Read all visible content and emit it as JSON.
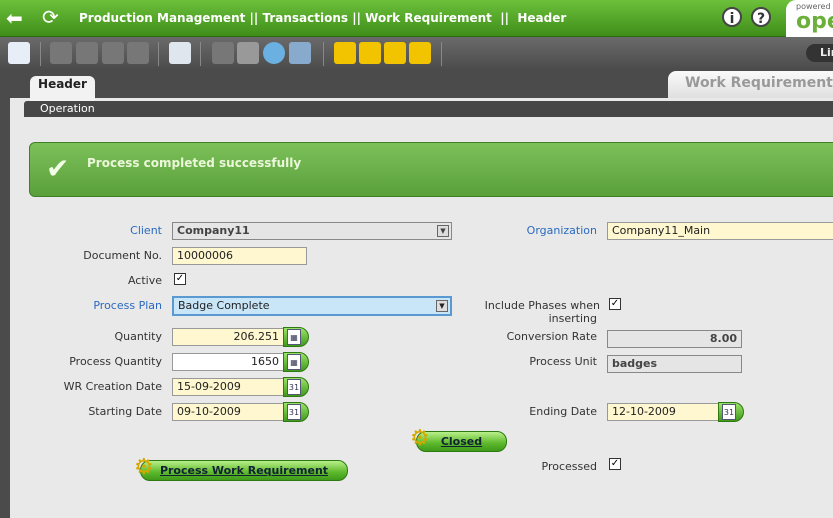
{
  "breadcrumb": "Production Management || Transactions || Work Requirement  ||  Header",
  "powered": {
    "line1": "powered",
    "line2": "ope"
  },
  "toolbar": {
    "link_label": "Lin"
  },
  "tabs": {
    "header": "Header",
    "window_title": "Work Requirement",
    "subtab": "Operation"
  },
  "message": "Process completed successfully",
  "colors": {
    "accent": "#4f9e24",
    "message_bg": "#6aae48"
  },
  "form": {
    "client": {
      "label": "Client",
      "value": "Company11"
    },
    "organization": {
      "label": "Organization",
      "value": "Company11_Main"
    },
    "document_no": {
      "label": "Document No.",
      "value": "10000006"
    },
    "active": {
      "label": "Active",
      "checked": true
    },
    "process_plan": {
      "label": "Process Plan",
      "value": "Badge Complete"
    },
    "include_phases": {
      "label1": "Include Phases when",
      "label2": "inserting",
      "checked": true
    },
    "quantity": {
      "label": "Quantity",
      "value": "206.251"
    },
    "conversion_rate": {
      "label": "Conversion Rate",
      "value": "8.00"
    },
    "process_quantity": {
      "label": "Process Quantity",
      "value": "1650"
    },
    "process_unit": {
      "label": "Process Unit",
      "value": "badges"
    },
    "wr_creation_date": {
      "label": "WR Creation Date",
      "value": "15-09-2009"
    },
    "starting_date": {
      "label": "Starting Date",
      "value": "09-10-2009"
    },
    "ending_date": {
      "label": "Ending Date",
      "value": "12-10-2009"
    },
    "closed_button": "Closed",
    "process_button": "Process Work Requirement",
    "processed": {
      "label": "Processed",
      "checked": true
    }
  },
  "icons": {
    "check": "✔",
    "calendar": "31",
    "calculator": "▦",
    "checkbox": "✓",
    "dropdown": "▼",
    "gear": "⚙",
    "info": "i",
    "help": "?"
  }
}
